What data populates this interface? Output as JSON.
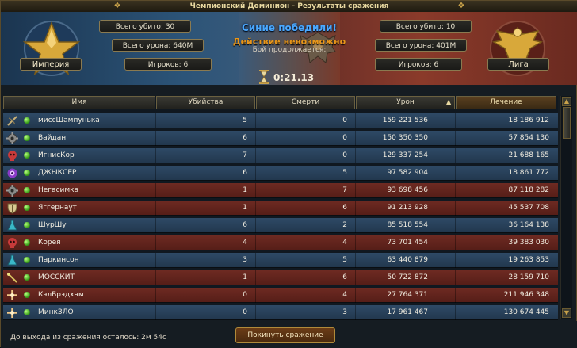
{
  "window": {
    "title": "Чемпионский Доминион - Результаты сражения"
  },
  "result": {
    "winner_text": "Синие победили!",
    "impossible_text": "Действие невозможно",
    "continues_text": "Бой продолжается:",
    "timer": "0:21.13"
  },
  "blue_team": {
    "name": "Империя",
    "total_kills": "Всего убито: 30",
    "total_damage": "Всего урона: 640M",
    "players": "Игроков: 6",
    "color": "#2c5478"
  },
  "red_team": {
    "name": "Лига",
    "total_kills": "Всего убито: 10",
    "total_damage": "Всего урона: 401M",
    "players": "Игроков: 6",
    "color": "#8a3a2a"
  },
  "table": {
    "columns": [
      "Имя",
      "Убийства",
      "Смерти",
      "Урон",
      "Лечение"
    ],
    "rows": [
      {
        "icon": "bow-icon",
        "name": "миссШампунька",
        "kills": "5",
        "deaths": "0",
        "damage": "159 221 536",
        "healing": "18 186 912",
        "team": "blue"
      },
      {
        "icon": "gear-icon",
        "name": "Вайдан",
        "kills": "6",
        "deaths": "0",
        "damage": "150 350 350",
        "healing": "57 854 130",
        "team": "blue"
      },
      {
        "icon": "skull-icon",
        "name": "ИгнисКор",
        "kills": "7",
        "deaths": "0",
        "damage": "129 337 254",
        "healing": "21 688 165",
        "team": "blue"
      },
      {
        "icon": "eye-icon",
        "name": "ДЖЫКСЕР",
        "kills": "6",
        "deaths": "5",
        "damage": "97 582 904",
        "healing": "18 861 772",
        "team": "blue"
      },
      {
        "icon": "gear-icon",
        "name": "Негасимка",
        "kills": "1",
        "deaths": "7",
        "damage": "93 698 456",
        "healing": "87 118 282",
        "team": "red"
      },
      {
        "icon": "shield-icon",
        "name": "Яггернаут",
        "kills": "1",
        "deaths": "6",
        "damage": "91 213 928",
        "healing": "45 537 708",
        "team": "red"
      },
      {
        "icon": "flask-icon",
        "name": "ШурШу",
        "kills": "6",
        "deaths": "2",
        "damage": "85 518 554",
        "healing": "36 164 138",
        "team": "blue"
      },
      {
        "icon": "skull-icon",
        "name": "Корея",
        "kills": "4",
        "deaths": "4",
        "damage": "73 701 454",
        "healing": "39 383 030",
        "team": "red"
      },
      {
        "icon": "flask-icon",
        "name": "Паркинсон",
        "kills": "3",
        "deaths": "5",
        "damage": "63 440 879",
        "healing": "19 263 853",
        "team": "blue"
      },
      {
        "icon": "staff-icon",
        "name": "МОССКИТ",
        "kills": "1",
        "deaths": "6",
        "damage": "50 722 872",
        "healing": "28 159 710",
        "team": "red"
      },
      {
        "icon": "cross-icon",
        "name": "КэлБрэдхам",
        "kills": "0",
        "deaths": "4",
        "damage": "27 764 371",
        "healing": "211 946 348",
        "team": "red"
      },
      {
        "icon": "cross-icon",
        "name": "МинкЗЛО",
        "kills": "0",
        "deaths": "3",
        "damage": "17 961 467",
        "healing": "130 674 445",
        "team": "blue"
      }
    ]
  },
  "footer": {
    "exit_text": "До выхода из сражения осталось:  2м 54с",
    "leave_button": "Покинуть сражение"
  }
}
